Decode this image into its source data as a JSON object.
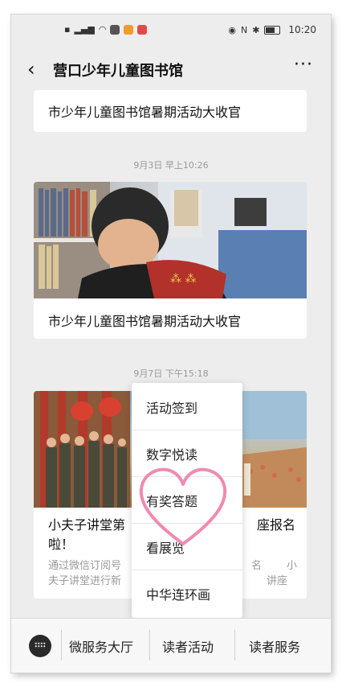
{
  "status_bar": {
    "left_icons": [
      "sim-icon",
      "signal-icon",
      "wifi-icon",
      "app-icon",
      "app-icon",
      "app-icon"
    ],
    "right_icons": [
      "eye-icon",
      "nfc-icon",
      "bluetooth-icon",
      "battery-icon"
    ],
    "time": "10:20"
  },
  "nav": {
    "title": "营口少年儿童图书馆",
    "more": "···"
  },
  "messages": [
    {
      "title": "市少年儿童图书馆暑期活动大收官"
    },
    {
      "timestamp": "9月3日 早上10:26",
      "title": "市少年儿童图书馆暑期活动大收官"
    },
    {
      "timestamp": "9月7日 下午15:18",
      "title_line1": "小夫子讲堂第",
      "title_line1_tail": "座报名",
      "title_line2": "啦！",
      "desc_line1_a": "通过微信订阅号",
      "desc_line1_b": "名",
      "desc_line1_c": "小",
      "desc_line2_a": "夫子讲堂进行新",
      "desc_line2_b": "讲座"
    }
  ],
  "popup_menu": {
    "items": [
      "活动签到",
      "数字悦读",
      "有奖答题",
      "看展览",
      "中华连环画"
    ]
  },
  "bottom_menu": {
    "items": [
      "微服务大厅",
      "读者活动",
      "读者服务"
    ]
  },
  "colors": {
    "heart": "#f08ab0",
    "background": "#ededed"
  }
}
